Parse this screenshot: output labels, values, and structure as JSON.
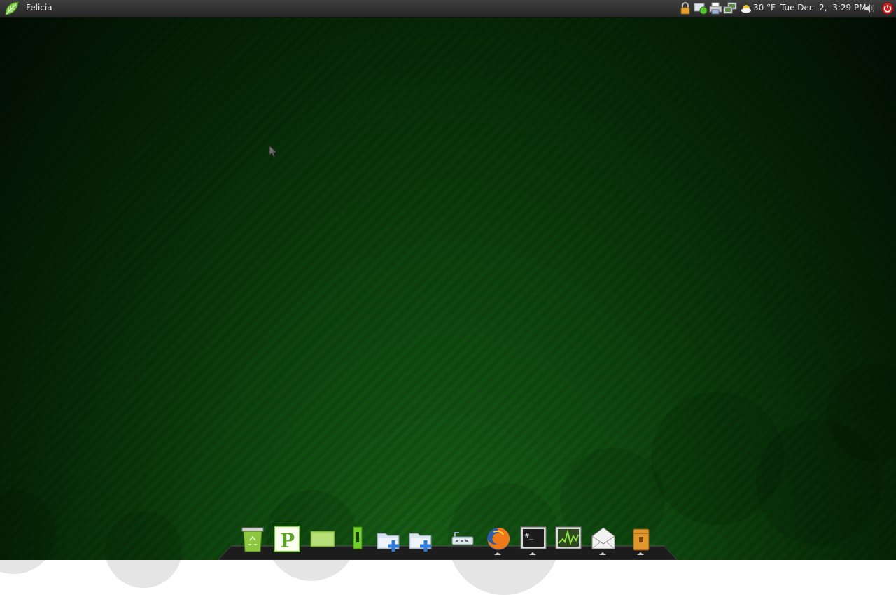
{
  "top_panel": {
    "menu_label": "Felicia",
    "weather_temp": "30 °F",
    "clock": "Tue Dec  2,  3:29 PM"
  },
  "tray_icons": [
    "lock-icon",
    "update-notifier-icon",
    "printer-icon",
    "network-icon",
    "weather-icon",
    "volume-icon",
    "power-icon"
  ],
  "dock": {
    "items": [
      "trash-icon",
      "publisher-icon",
      "folder-icon",
      "usb-drive-icon",
      "new-folder-icon",
      "new-folder-icon",
      "router-icon",
      "firefox-icon",
      "terminal-icon",
      "system-monitor-icon",
      "mail-icon",
      "archive-icon"
    ]
  },
  "colors": {
    "accent_green": "#7ac943",
    "panel_bg": "#2e2e2e",
    "power_red": "#d42020"
  }
}
